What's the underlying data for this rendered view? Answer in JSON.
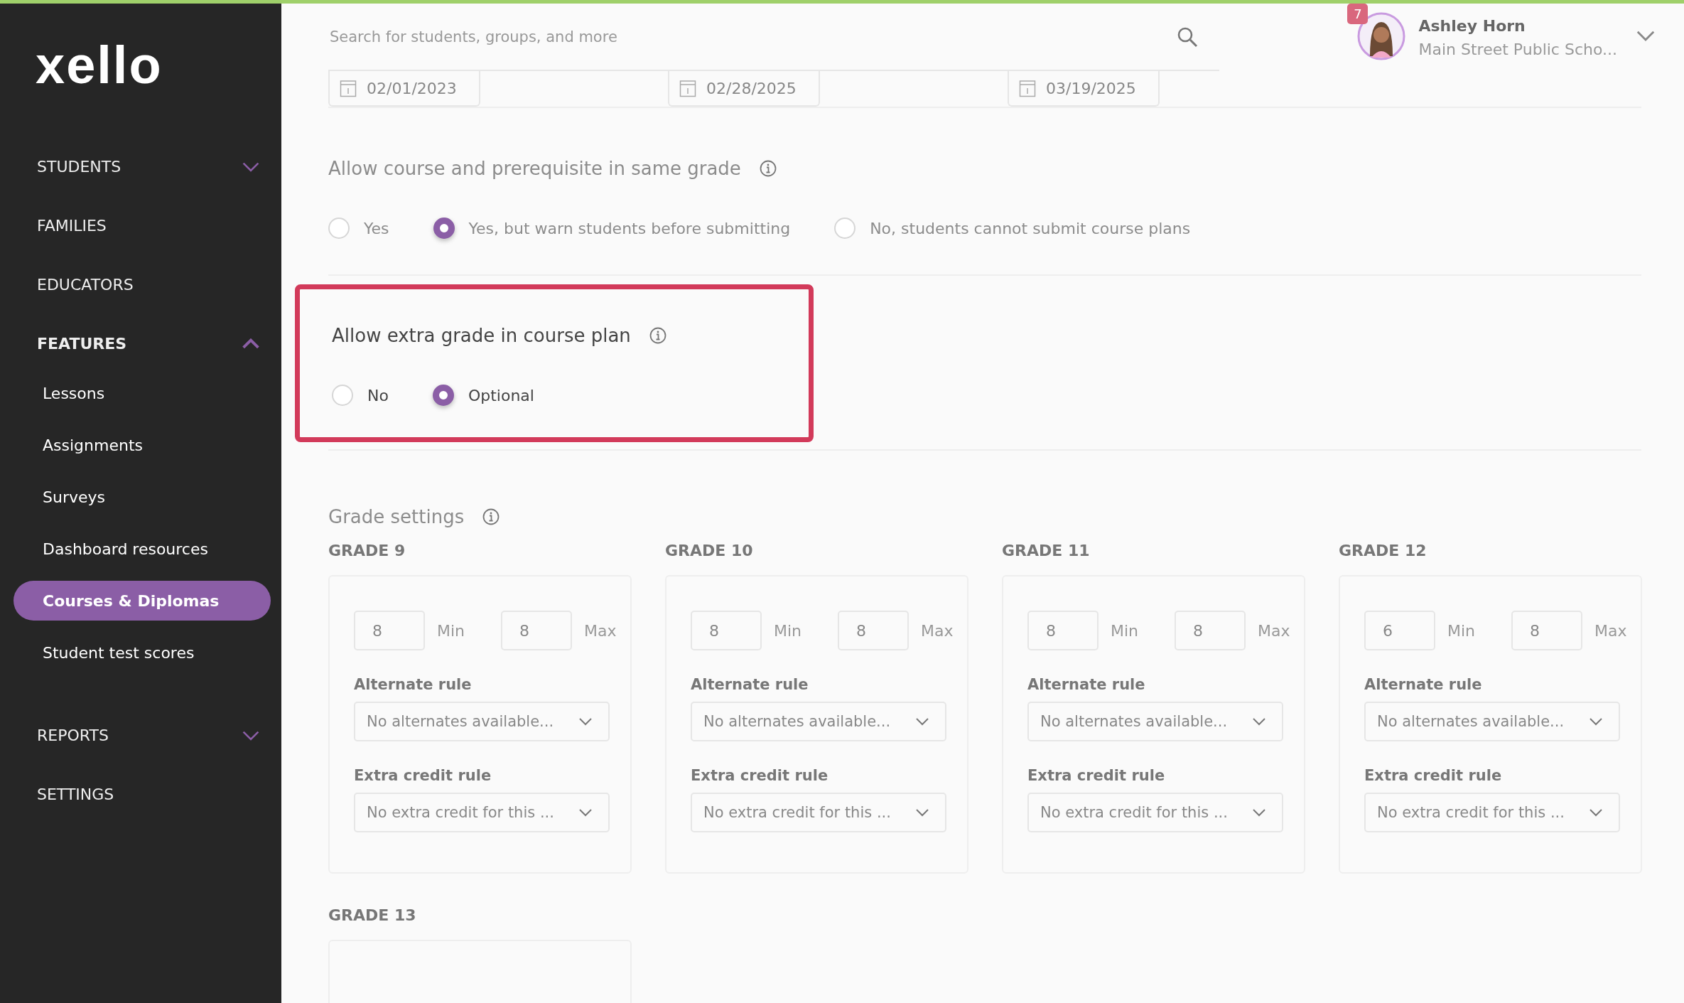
{
  "brand": {
    "logo": "xello"
  },
  "sidebar": {
    "items": [
      {
        "label": "STUDENTS",
        "expanded": false
      },
      {
        "label": "FAMILIES"
      },
      {
        "label": "EDUCATORS"
      },
      {
        "label": "FEATURES",
        "expanded": true,
        "children": [
          {
            "label": "Lessons",
            "selected": false
          },
          {
            "label": "Assignments",
            "selected": false
          },
          {
            "label": "Surveys",
            "selected": false
          },
          {
            "label": "Dashboard resources",
            "selected": false
          },
          {
            "label": "Courses & Diplomas",
            "selected": true
          },
          {
            "label": "Student test scores",
            "selected": false
          }
        ]
      },
      {
        "label": "REPORTS",
        "expanded": false
      },
      {
        "label": "SETTINGS"
      }
    ]
  },
  "search": {
    "placeholder": "Search for students, groups, and more"
  },
  "user": {
    "name": "Ashley Horn",
    "school": "Main Street Public Scho...",
    "notifications": "7"
  },
  "dates": [
    "02/01/2023",
    "02/28/2025",
    "03/19/2025"
  ],
  "settings": [
    {
      "title": "Allow course and prerequisite in same grade",
      "highlighted": false,
      "options": [
        {
          "label": "Yes",
          "selected": false
        },
        {
          "label": "Yes, but warn students before submitting",
          "selected": true
        },
        {
          "label": "No, students cannot submit course plans",
          "selected": false
        }
      ]
    },
    {
      "title": "Allow extra grade in course plan",
      "highlighted": true,
      "options": [
        {
          "label": "No",
          "selected": false
        },
        {
          "label": "Optional",
          "selected": true
        }
      ]
    }
  ],
  "grade_settings": {
    "title": "Grade settings",
    "grades": [
      {
        "label": "GRADE 9",
        "min": "8",
        "min_label": "Min",
        "max": "8",
        "max_label": "Max",
        "alternate_label": "Alternate rule",
        "alternate_value": "No alternates available...",
        "extra_label": "Extra credit rule",
        "extra_value": "No extra credit for this ..."
      },
      {
        "label": "GRADE 10",
        "min": "8",
        "min_label": "Min",
        "max": "8",
        "max_label": "Max",
        "alternate_label": "Alternate rule",
        "alternate_value": "No alternates available...",
        "extra_label": "Extra credit rule",
        "extra_value": "No extra credit for this ..."
      },
      {
        "label": "GRADE 11",
        "min": "8",
        "min_label": "Min",
        "max": "8",
        "max_label": "Max",
        "alternate_label": "Alternate rule",
        "alternate_value": "No alternates available...",
        "extra_label": "Extra credit rule",
        "extra_value": "No extra credit for this ..."
      },
      {
        "label": "GRADE 12",
        "min": "6",
        "min_label": "Min",
        "max": "8",
        "max_label": "Max",
        "alternate_label": "Alternate rule",
        "alternate_value": "No alternates available...",
        "extra_label": "Extra credit rule",
        "extra_value": "No extra credit for this ..."
      },
      {
        "label": "GRADE 13"
      }
    ]
  }
}
